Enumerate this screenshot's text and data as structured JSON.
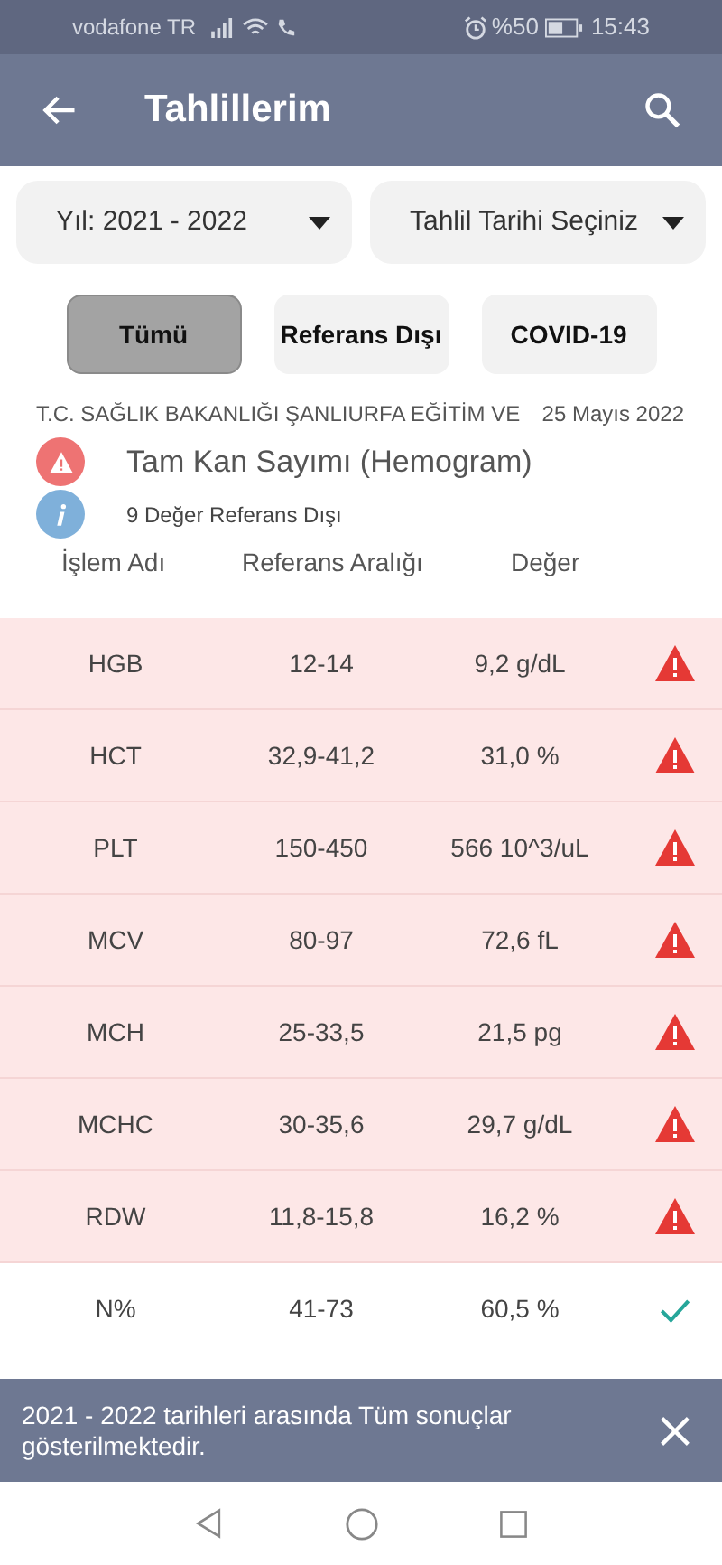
{
  "status_bar": {
    "carrier": "vodafone TR",
    "battery": "%50",
    "time": "15:43"
  },
  "app_bar": {
    "title": "Tahlillerim"
  },
  "dropdowns": [
    {
      "value": "Yıl: 2021 - 2022"
    },
    {
      "value": "Tahlil Tarihi Seçiniz"
    }
  ],
  "filters": [
    {
      "label": "Tümü",
      "selected": true
    },
    {
      "label": "Referans Dışı",
      "selected": false
    },
    {
      "label": "COVID-19",
      "selected": false
    }
  ],
  "result": {
    "institution": "T.C. SAĞLIK BAKANLIĞI ŞANLIURFA EĞİTİM VE",
    "date": "25 Mayıs 2022",
    "test": "Tam Kan Sayımı (Hemogram)",
    "summary": "9 Değer Referans Dışı"
  },
  "table": {
    "columns": [
      "İşlem Adı",
      "Referans Aralığı",
      "Değer"
    ],
    "rows": [
      {
        "name": "HGB",
        "range": "12-14",
        "value": "9,2 g/dL",
        "out_of_range": true
      },
      {
        "name": "HCT",
        "range": "32,9-41,2",
        "value": "31,0 %",
        "out_of_range": true
      },
      {
        "name": "PLT",
        "range": "150-450",
        "value": "566 10^3/uL",
        "out_of_range": true
      },
      {
        "name": "MCV",
        "range": "80-97",
        "value": "72,6 fL",
        "out_of_range": true
      },
      {
        "name": "MCH",
        "range": "25-33,5",
        "value": "21,5 pg",
        "out_of_range": true
      },
      {
        "name": "MCHC",
        "range": "30-35,6",
        "value": "29,7 g/dL",
        "out_of_range": true
      },
      {
        "name": "RDW",
        "range": "11,8-15,8",
        "value": "16,2 %",
        "out_of_range": true
      },
      {
        "name": "N%",
        "range": "41-73",
        "value": "60,5 %",
        "out_of_range": false
      }
    ]
  },
  "snackbar": {
    "message": "2021 - 2022 tarihleri arasında Tüm sonuçlar gösterilmektedir."
  }
}
